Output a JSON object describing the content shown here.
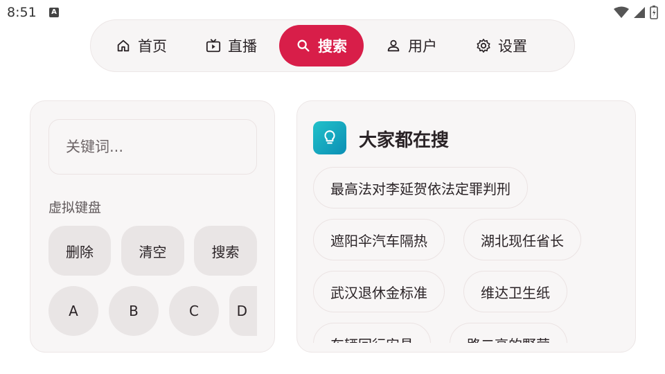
{
  "status_bar": {
    "time": "8:51",
    "notif_letter": "A"
  },
  "nav": {
    "items": [
      {
        "label": "首页",
        "icon": "home-icon"
      },
      {
        "label": "直播",
        "icon": "tv-icon"
      },
      {
        "label": "搜索",
        "icon": "search-icon",
        "active": true
      },
      {
        "label": "用户",
        "icon": "user-icon"
      },
      {
        "label": "设置",
        "icon": "gear-icon"
      }
    ],
    "active_color": "#d81e49"
  },
  "search": {
    "placeholder": "关键词..."
  },
  "keyboard": {
    "label": "虚拟键盘",
    "actions": [
      "删除",
      "清空",
      "搜索"
    ],
    "keys": [
      "A",
      "B",
      "C",
      "D"
    ]
  },
  "trending": {
    "title": "大家都在搜",
    "icon": "lightbulb-icon",
    "items": [
      "最高法对李延贺依法定罪判刑",
      "遮阳伞汽车隔热",
      "湖北现任省长",
      "武汉退休金标准",
      "维达卫生纸",
      "车辆回行安昌",
      "路二高的野营"
    ]
  }
}
